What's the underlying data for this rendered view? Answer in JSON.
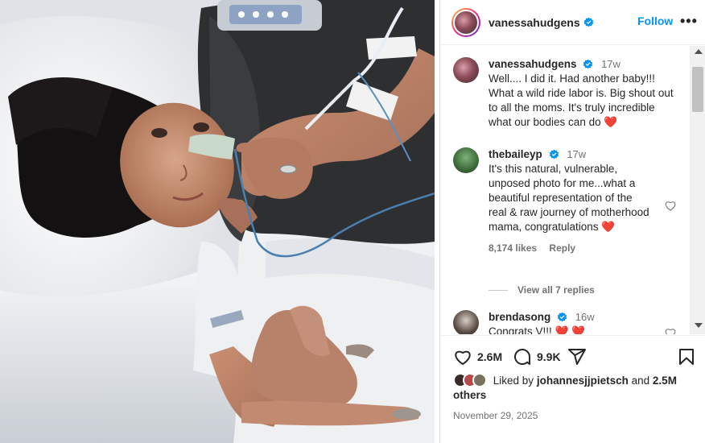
{
  "post": {
    "username": "vanessahudgens",
    "follow_label": "Follow",
    "more_label": "•••"
  },
  "comments": [
    {
      "username": "vanessahudgens",
      "time": "17w",
      "text": "Well.... I did it. Had another baby!!! What a wild ride labor is. Big shout out to all the moms. It's truly incredible what our bodies can do ❤️"
    },
    {
      "username": "thebaileyp",
      "time": "17w",
      "text": "It's this natural, vulnerable, unposed photo for me...what a beautiful representation of the real & raw journey of motherhood mama, congratulations ❤️",
      "likes": "8,174 likes",
      "reply_label": "Reply",
      "view_replies": "View all 7 replies"
    },
    {
      "username": "brendasong",
      "time": "16w",
      "text": "Congrats V!!! ❤️ ❤️"
    }
  ],
  "actions": {
    "likes_count": "2.6M",
    "comments_count": "9.9K"
  },
  "liked_by": {
    "prefix": "Liked by",
    "user": "johannesjjpietsch",
    "middle": "and",
    "count": "2.5M",
    "suffix": "others"
  },
  "date": "November 29, 2025",
  "colors": {
    "accent": "#0095f6",
    "verified": "#0095f6",
    "heart_red": "#ed4956",
    "muted": "#737373"
  },
  "icons": [
    "heart-icon",
    "comment-icon",
    "share-icon",
    "bookmark-icon",
    "verified-icon",
    "more-icon"
  ]
}
